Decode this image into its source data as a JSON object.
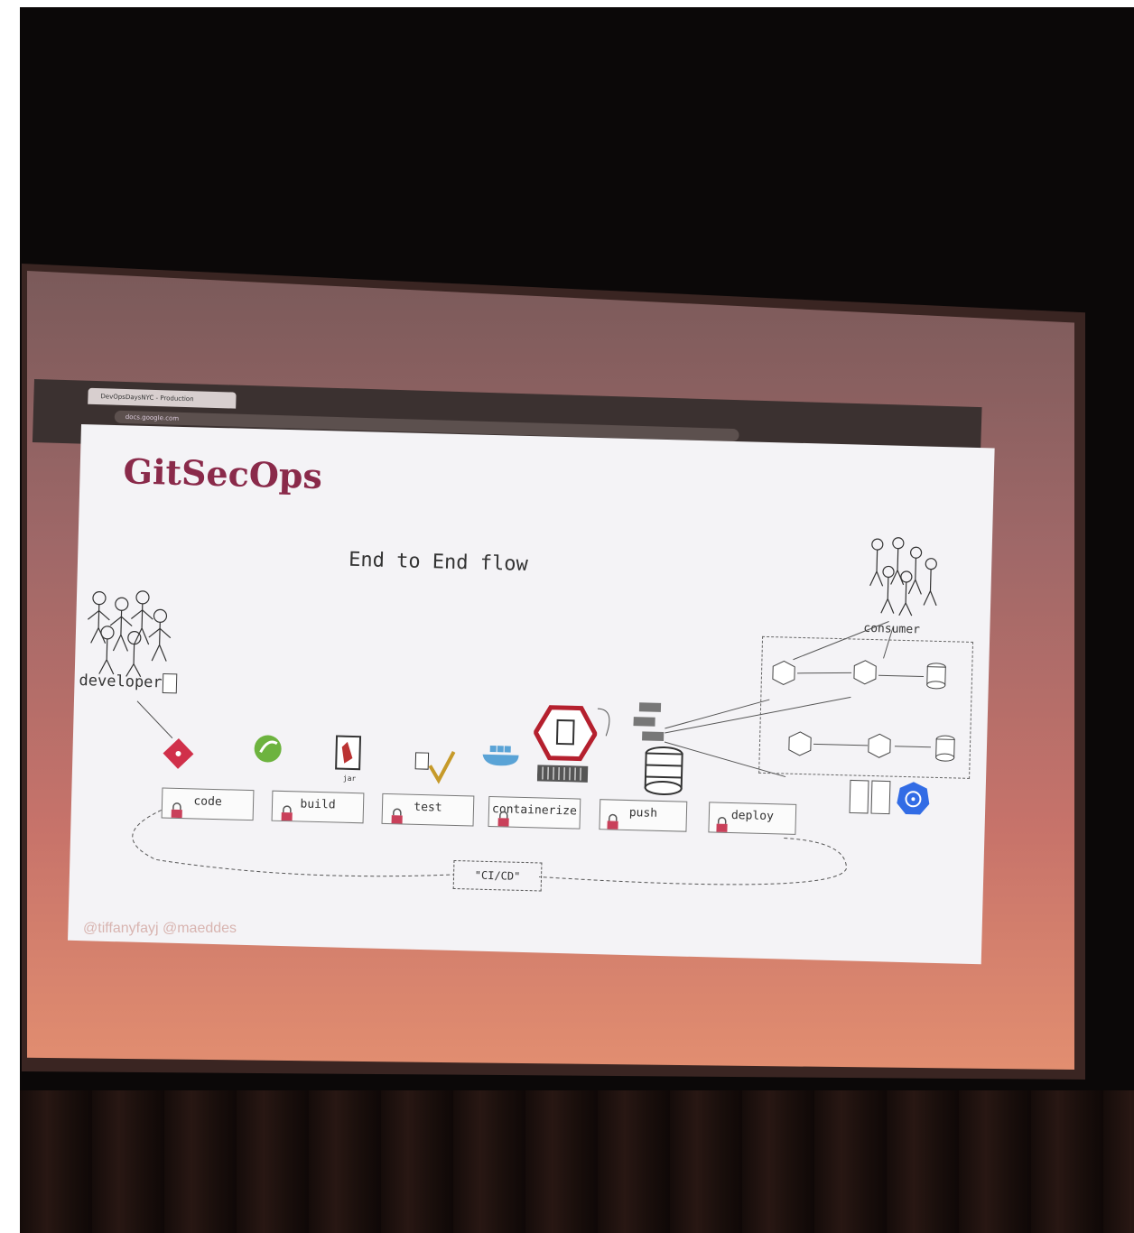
{
  "browser": {
    "tab_title": "DevOpsDaysNYC - Production",
    "url": "docs.google.com",
    "toolbar_icons": "⊙ ☆ ▦ ◐ ▣ ◉ ▤ ▥ ◧ ◨ ▧"
  },
  "slide": {
    "title": "GitSecOps",
    "subtitle": "End to End flow",
    "developer_label": "developer",
    "consumer_label": "consumer",
    "jar_label": "jar",
    "stages": [
      {
        "label": "code"
      },
      {
        "label": "build"
      },
      {
        "label": "test"
      },
      {
        "label": "containerize"
      },
      {
        "label": "push"
      },
      {
        "label": "deploy"
      }
    ],
    "cicd_label": "\"CI/CD\"",
    "handles": "@tiffanyfayj @maeddes",
    "accent_color": "#8a2a4a",
    "git_color": "#d0304a",
    "spring_color": "#6db33f",
    "kubernetes_color": "#326ce5"
  }
}
